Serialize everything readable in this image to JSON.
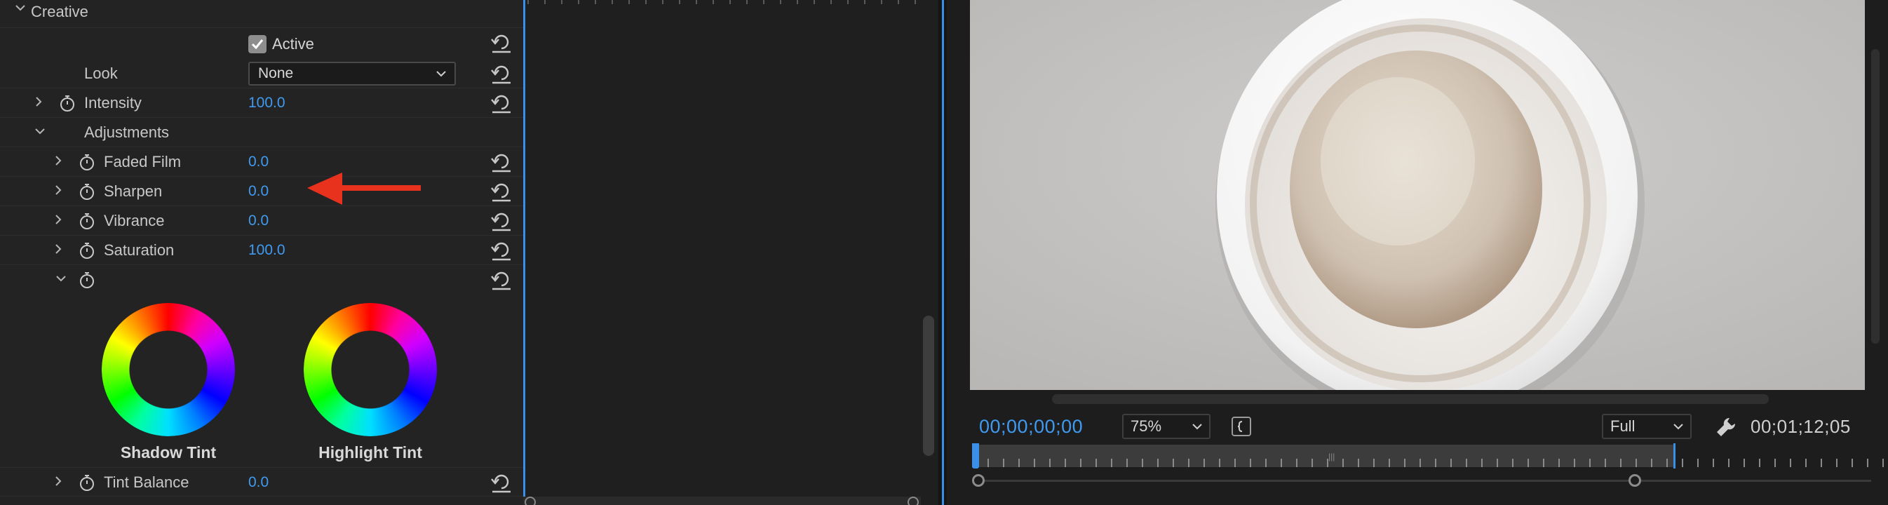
{
  "effect_controls": {
    "section_creative": "Creative",
    "active_label": "Active",
    "active_checked": true,
    "look_label": "Look",
    "look_value": "None",
    "intensity_label": "Intensity",
    "intensity_value": "100.0",
    "adjustments_label": "Adjustments",
    "faded_film_label": "Faded Film",
    "faded_film_value": "0.0",
    "sharpen_label": "Sharpen",
    "sharpen_value": "0.0",
    "vibrance_label": "Vibrance",
    "vibrance_value": "0.0",
    "saturation_label": "Saturation",
    "saturation_value": "100.0",
    "shadow_tint_label": "Shadow Tint",
    "highlight_tint_label": "Highlight Tint",
    "tint_balance_label": "Tint Balance",
    "tint_balance_value": "0.0"
  },
  "program_monitor": {
    "current_timecode": "00;00;00;00",
    "zoom_value": "75%",
    "resolution_value": "Full",
    "duration_timecode": "00;01;12;05"
  },
  "icons": [
    "chevron-down-icon",
    "chevron-right-icon",
    "stopwatch-icon",
    "reset-icon",
    "checkmark-icon",
    "red-arrow-icon",
    "wrench-icon",
    "bracket-icon"
  ],
  "colors": {
    "accent_blue": "#3f9af0",
    "annotation_red": "#e8321e",
    "panel_bg": "#232323"
  }
}
